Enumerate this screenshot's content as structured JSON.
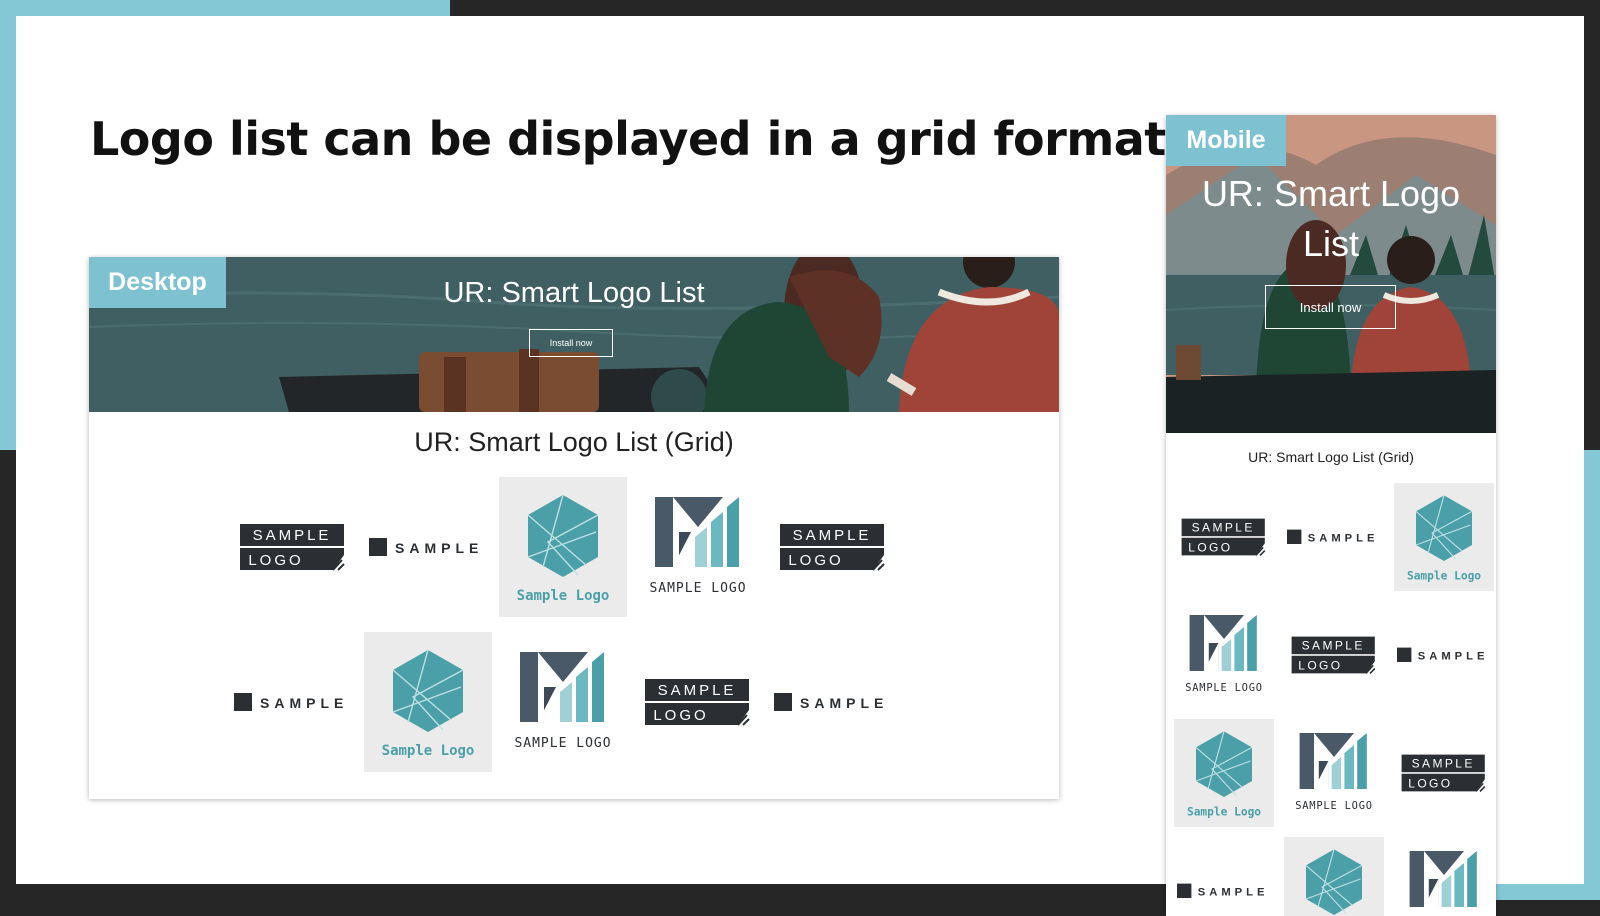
{
  "slide": {
    "headline": "Logo list can be displayed in a grid format!"
  },
  "desktop": {
    "tag": "Desktop",
    "banner_title": "UR: Smart Logo List",
    "install_label": "Install now",
    "section_title": "UR: Smart Logo List (Grid)",
    "logos": [
      "sample-logo-block",
      "sample-wordmark",
      "sample-logo-hexagon",
      "sample-logo-m",
      "sample-logo-block",
      "sample-wordmark",
      "sample-logo-hexagon",
      "sample-logo-m",
      "sample-logo-block",
      "sample-wordmark"
    ]
  },
  "mobile": {
    "tag": "Mobile",
    "banner_title": "UR: Smart Logo List",
    "install_label": "Install now",
    "section_title": "UR: Smart Logo List (Grid)",
    "logos": [
      "sample-logo-block",
      "sample-wordmark",
      "sample-logo-hexagon",
      "sample-logo-m",
      "sample-logo-block",
      "sample-wordmark",
      "sample-logo-hexagon",
      "sample-logo-m",
      "sample-logo-block",
      "sample-wordmark",
      "sample-logo-hexagon",
      "sample-logo-m"
    ]
  },
  "logo_text": {
    "block_top": "SAMPLE",
    "block_bottom": "LOGO",
    "wordmark": "SAMPLE",
    "hexagon_caption": "Sample Logo",
    "m_caption": "SAMPLE LOGO"
  },
  "colors": {
    "accent": "#84c8d6",
    "frame": "#262626",
    "teal": "#4a9fa8",
    "slate": "#3b4a56"
  }
}
